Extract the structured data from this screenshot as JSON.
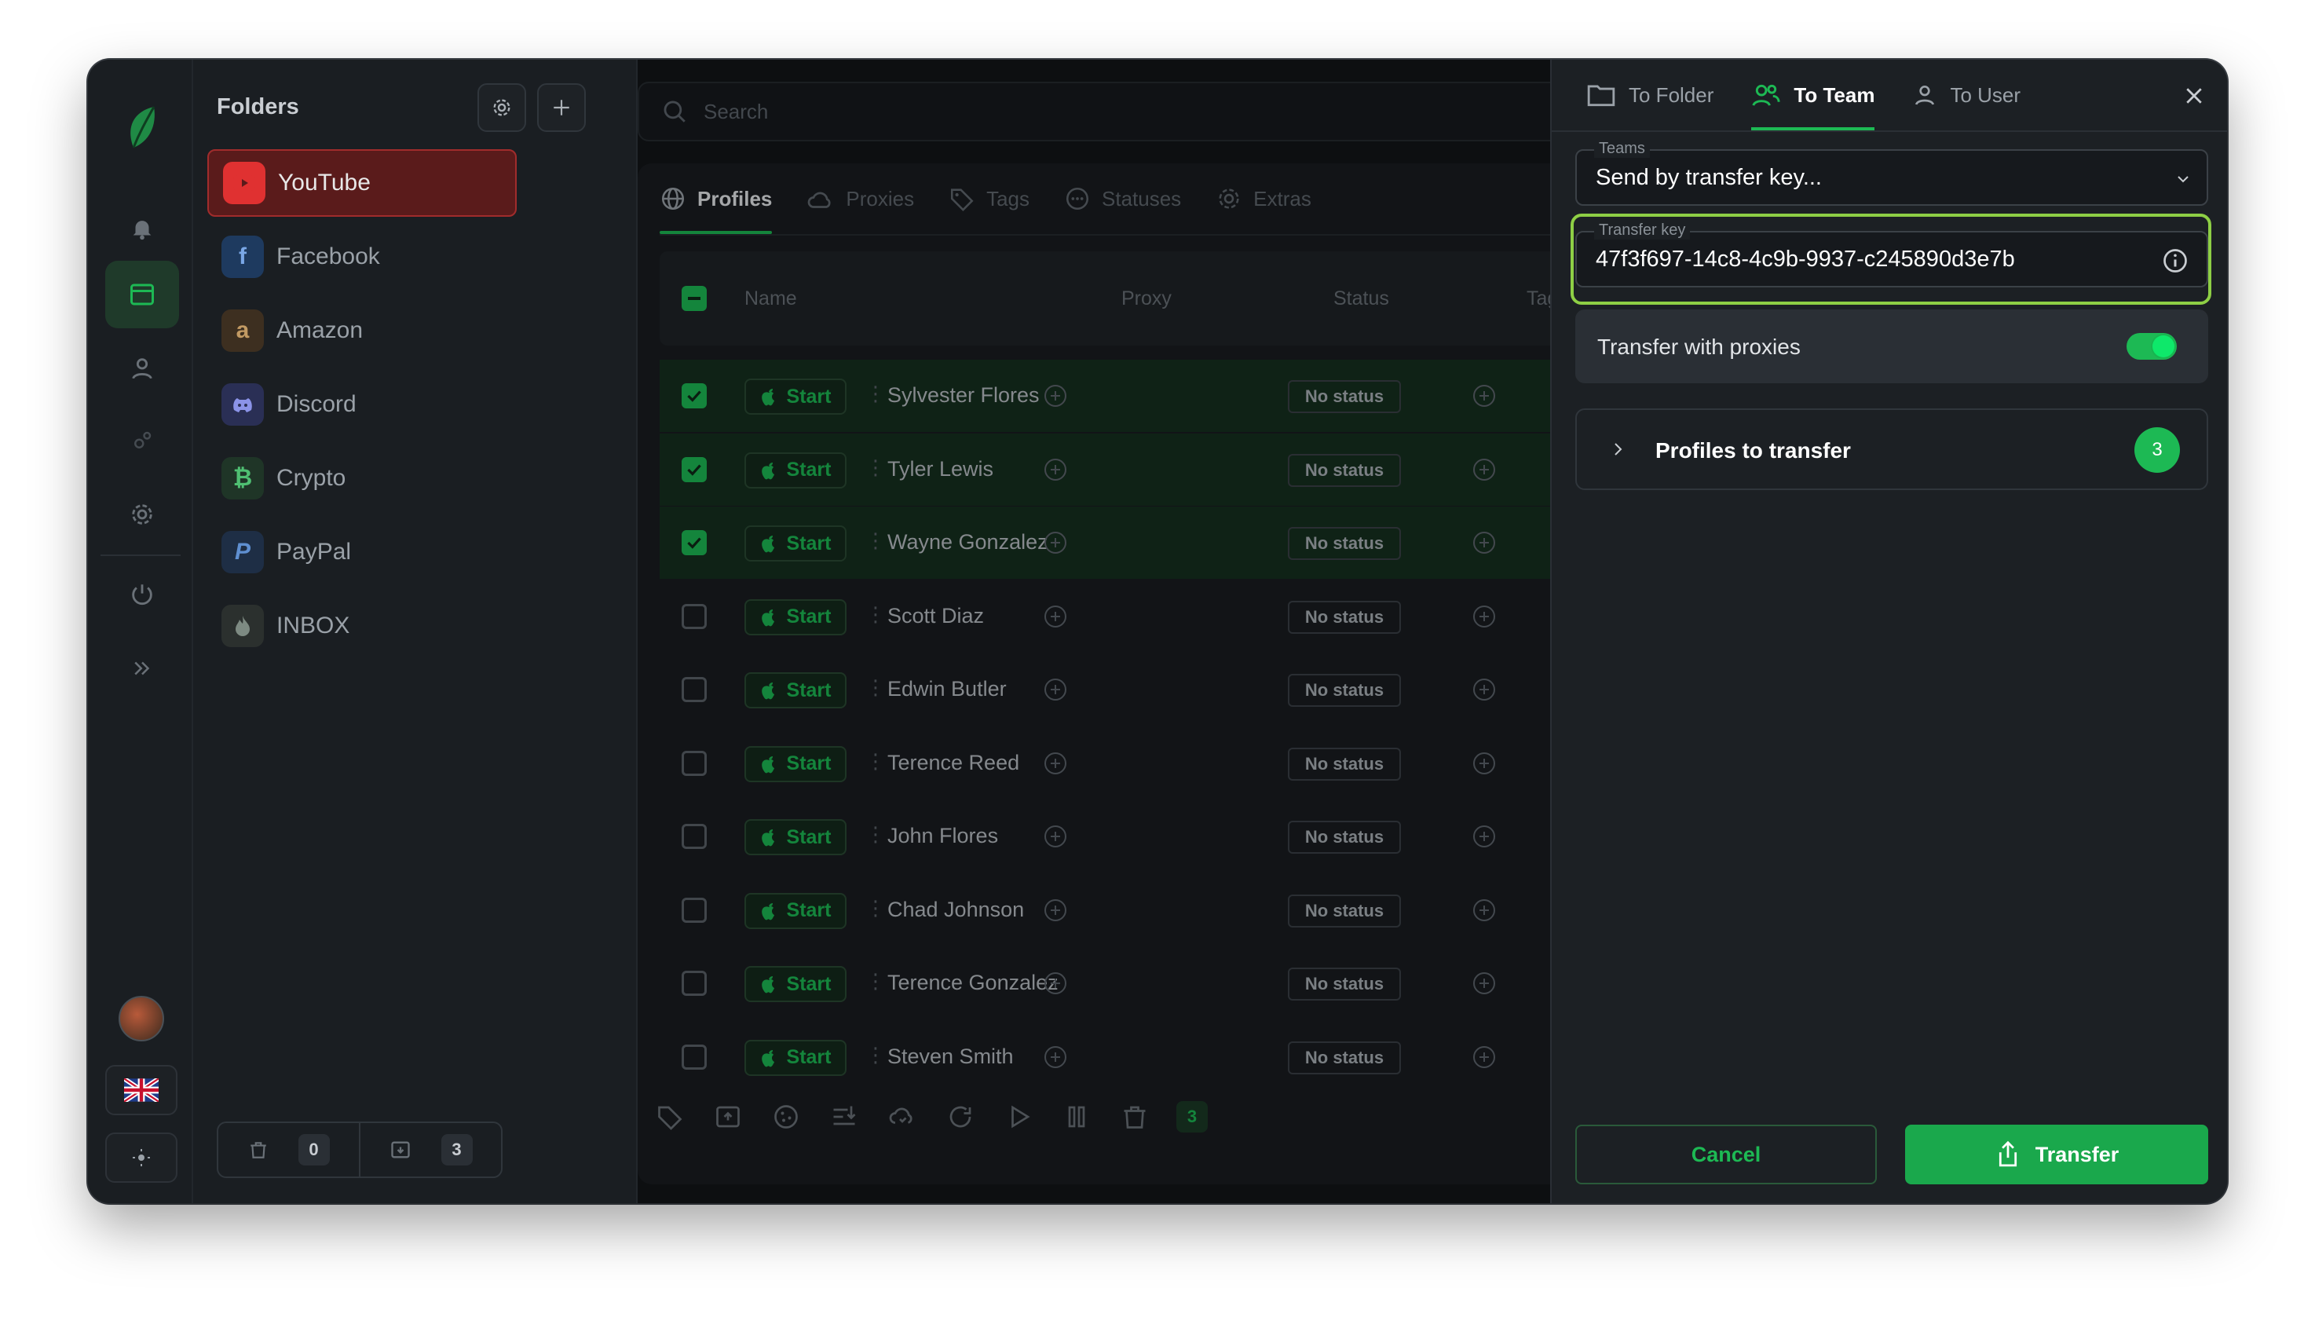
{
  "sidebar_folders": {
    "title": "Folders",
    "items": [
      {
        "label": "YouTube",
        "icon": "youtube-icon",
        "color": "#e03131"
      },
      {
        "label": "Facebook",
        "icon": "facebook-icon",
        "color": "#1e3a5f"
      },
      {
        "label": "Amazon",
        "icon": "amazon-icon",
        "color": "#3d2f20"
      },
      {
        "label": "Discord",
        "icon": "discord-icon",
        "color": "#2a2f55"
      },
      {
        "label": "Crypto",
        "icon": "bitcoin-icon",
        "color": "#1f3527"
      },
      {
        "label": "PayPal",
        "icon": "paypal-icon",
        "color": "#1e2e45"
      },
      {
        "label": "INBOX",
        "icon": "fire-icon",
        "color": "#2b302e"
      }
    ],
    "trash_count": "0",
    "archive_count": "3"
  },
  "search": {
    "placeholder": "Search"
  },
  "main_tabs": [
    "Profiles",
    "Proxies",
    "Tags",
    "Statuses",
    "Extras"
  ],
  "table": {
    "columns": [
      "Name",
      "Proxy",
      "Status",
      "Tags"
    ],
    "start_label": "Start",
    "status_label": "No status",
    "rows": [
      {
        "name": "Sylvester Flores",
        "selected": true
      },
      {
        "name": "Tyler Lewis",
        "selected": true
      },
      {
        "name": "Wayne Gonzalez",
        "selected": true
      },
      {
        "name": "Scott Diaz",
        "selected": false
      },
      {
        "name": "Edwin Butler",
        "selected": false
      },
      {
        "name": "Terence Reed",
        "selected": false
      },
      {
        "name": "John Flores",
        "selected": false
      },
      {
        "name": "Chad Johnson",
        "selected": false
      },
      {
        "name": "Terence Gonzalez",
        "selected": false
      },
      {
        "name": "Steven Smith",
        "selected": false
      }
    ]
  },
  "toolbar": {
    "selected_count": "3"
  },
  "transfer_panel": {
    "tabs": [
      "To Folder",
      "To Team",
      "To User"
    ],
    "active_tab": "To Team",
    "teams_label": "Teams",
    "teams_value": "Send by transfer key...",
    "key_label": "Transfer key",
    "key_value": "47f3f697-14c8-4c9b-9937-c245890d3e7b",
    "proxies_label": "Transfer with proxies",
    "proxies_enabled": true,
    "profiles_label": "Profiles to transfer",
    "profiles_count": "3",
    "cancel_label": "Cancel",
    "transfer_label": "Transfer"
  },
  "colors": {
    "accent": "#1db954",
    "focus_ring": "#8ecf45",
    "danger": "#a12c2c"
  }
}
